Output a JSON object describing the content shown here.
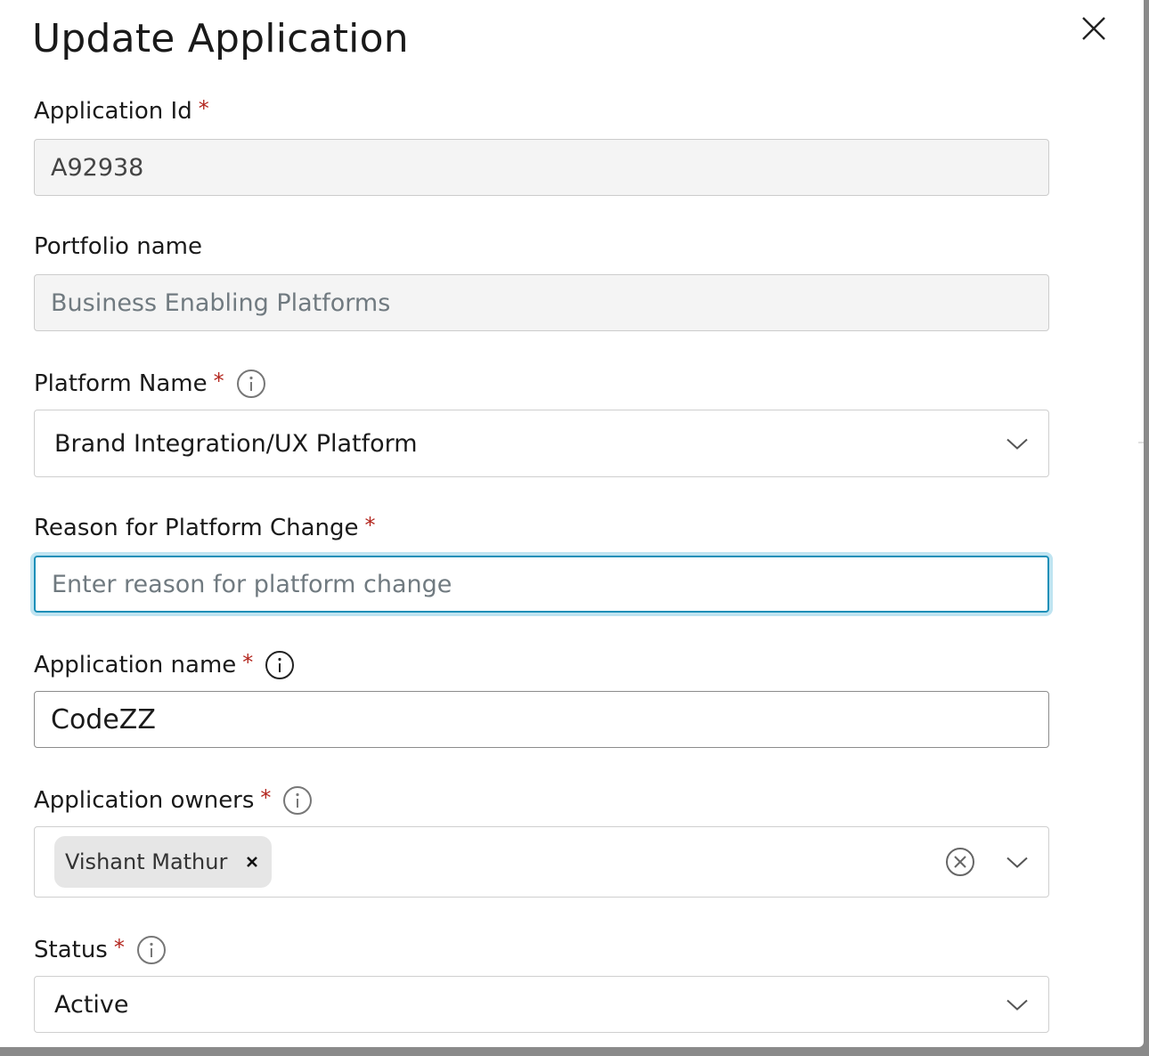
{
  "dialog": {
    "title": "Update Application"
  },
  "fields": {
    "application_id": {
      "label": "Application Id",
      "required": "*",
      "value": "A92938"
    },
    "portfolio_name": {
      "label": "Portfolio name",
      "value": "Business Enabling Platforms"
    },
    "platform_name": {
      "label": "Platform Name",
      "required": "*",
      "value": "Brand Integration/UX Platform"
    },
    "reason": {
      "label": "Reason for Platform Change",
      "required": "*",
      "placeholder": "Enter reason for platform change",
      "value": ""
    },
    "application_name": {
      "label": "Application name",
      "required": "*",
      "value": "CodeZZ"
    },
    "owners": {
      "label": "Application owners",
      "required": "*",
      "chips": [
        "Vishant Mathur"
      ]
    },
    "status": {
      "label": "Status",
      "required": "*",
      "value": "Active"
    }
  },
  "icons": {
    "close": "close-icon",
    "info": "info-icon",
    "chevron": "chevron-down-icon",
    "clear": "clear-circle-icon",
    "remove_chip": "x-icon"
  },
  "colors": {
    "required": "#b3261e",
    "focus_border": "#1a8fb8",
    "focus_ring": "#bfe4f1",
    "disabled_bg": "#f4f4f4",
    "chip_bg": "#e6e6e6"
  }
}
